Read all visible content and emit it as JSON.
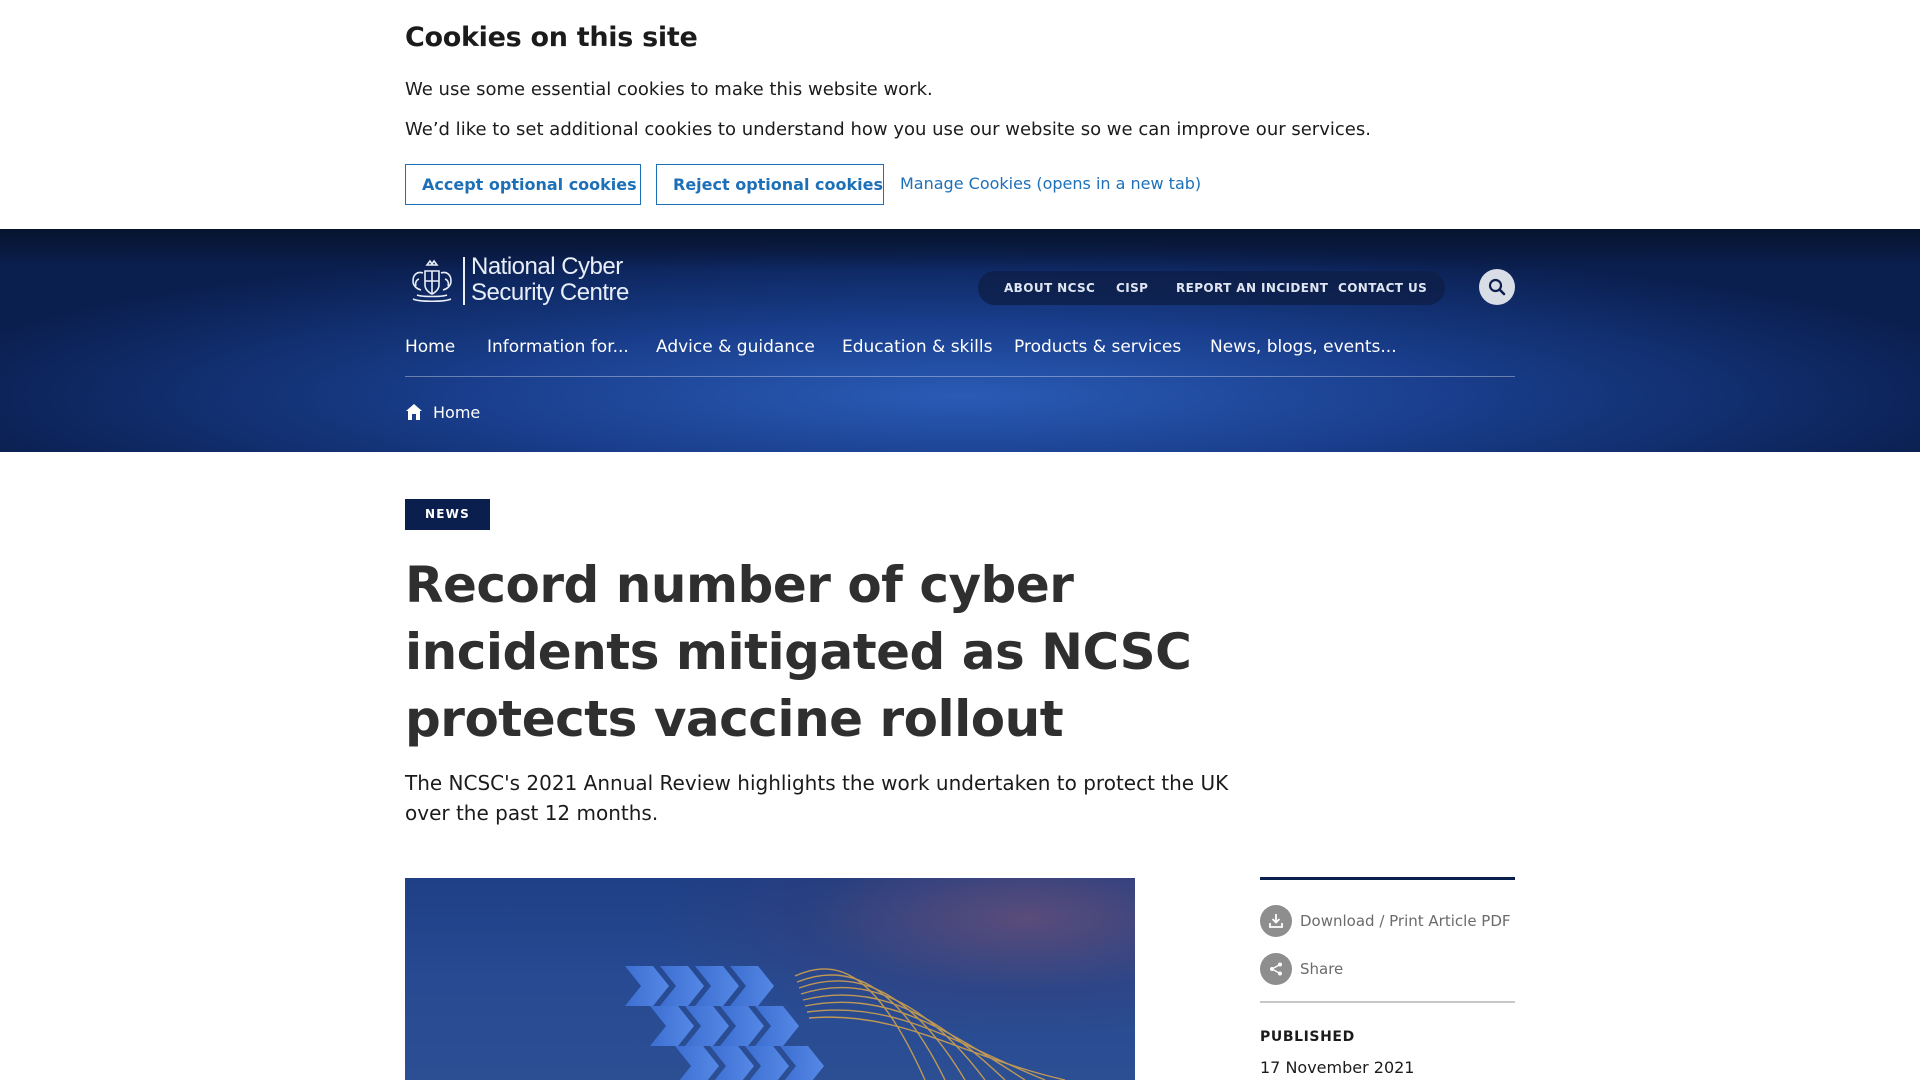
{
  "cookie_banner": {
    "title": "Cookies on this site",
    "line1": "We use some essential cookies to make this website work.",
    "line2": "We’d like to set additional cookies to understand how you use our website so we can improve our services.",
    "accept_label": "Accept optional cookies",
    "reject_label": "Reject optional cookies",
    "manage_label": "Manage Cookies (opens in a new tab)"
  },
  "header": {
    "logo_line1": "National Cyber",
    "logo_line2": "Security Centre",
    "utility_nav": [
      "ABOUT NCSC",
      "CISP",
      "REPORT AN INCIDENT",
      "CONTACT US"
    ],
    "main_nav": [
      "Home",
      "Information for...",
      "Advice & guidance",
      "Education & skills",
      "Products & services",
      "News, blogs, events..."
    ],
    "breadcrumb": "Home"
  },
  "article": {
    "tag": "NEWS",
    "headline": "Record number of cyber incidents mitigated as NCSC protects vaccine rollout",
    "summary": "The NCSC's 2021 Annual Review highlights the work undertaken to protect the UK over the past 12 months."
  },
  "sidebar": {
    "download_label": "Download / Print Article PDF",
    "share_label": "Share",
    "published_label": "PUBLISHED",
    "published_date": "17 November 2021"
  },
  "colors": {
    "accent_link": "#1d70b8",
    "navy": "#0b1f4f",
    "header_blue": "#1a3f8e"
  }
}
